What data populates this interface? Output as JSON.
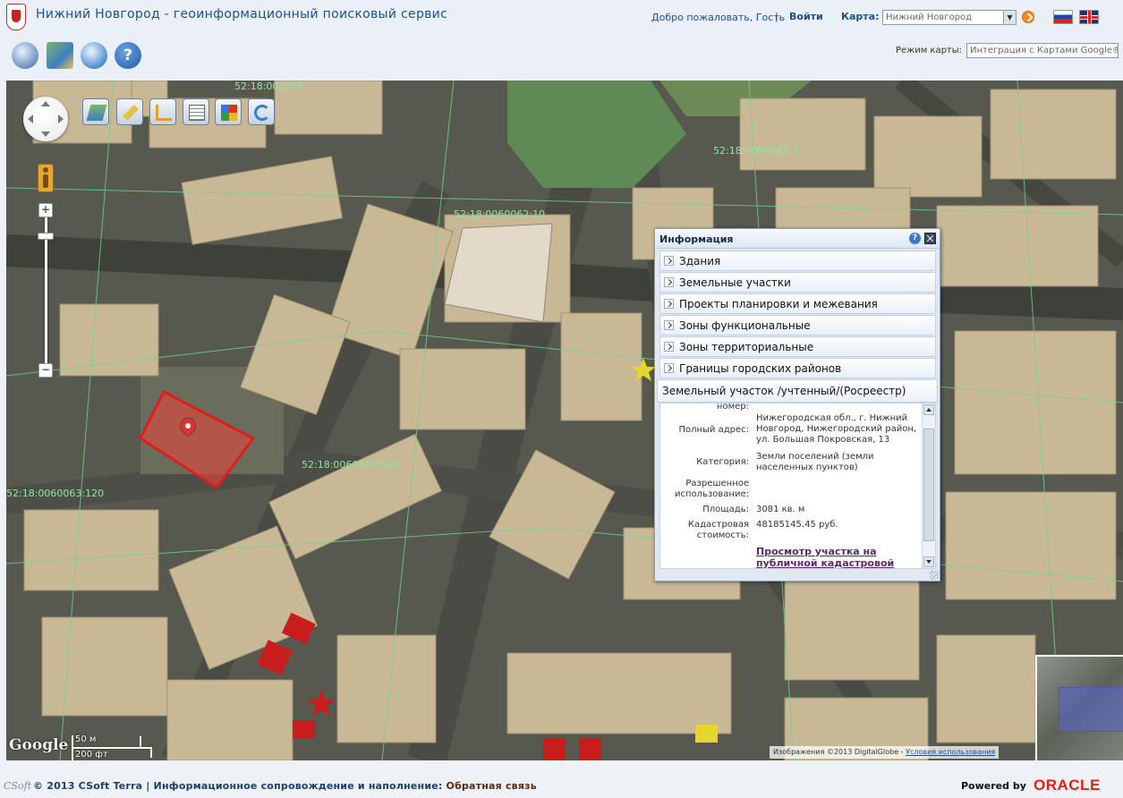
{
  "header": {
    "site_title": "Нижний Новгород - геоинформационный поисковый сервис",
    "welcome": "Добро пожаловать, Гость",
    "separator": "|",
    "login": "Войти",
    "map_label": "Карта:",
    "map_select_value": "Нижний Новгород",
    "map_mode_label": "Режим карты:",
    "map_mode_value": "Интеграция с Картами Google®"
  },
  "toolbar": {
    "help_glyph": "?"
  },
  "map": {
    "zoom_in": "+",
    "zoom_out": "−",
    "google_logo": "Google",
    "scale_metric": "50 м",
    "scale_imperial": "200 фт",
    "attribution_text": "Изображения ©2013 DigitalGlobe - ",
    "attribution_link": "Условия использования",
    "parcel_labels": [
      "52:18:0060062:10",
      "52:18:0060063:120",
      "52:18:0060062:1",
      "52:18:0060063:120",
      "52:18:006006"
    ]
  },
  "info_panel": {
    "title": "Информация",
    "help_glyph": "?",
    "sections": [
      "Здания",
      "Земельные участки",
      "Проекты планировки и межевания",
      "Зоны функциональные",
      "Зоны территориальные",
      "Границы городских районов"
    ],
    "open_section": "Земельный участок /учтенный/(Росреестр)",
    "details": {
      "number_label": "номер:",
      "address_label": "Полный адрес:",
      "address_value": "Нижегородская обл., г. Нижний Новгород, Нижегородский район, ул. Большая Покровская, 13",
      "category_label": "Категория:",
      "category_value": "Земли поселений (земли населенных пунктов)",
      "usage_label": "Разрешенное использование:",
      "area_label": "Площадь:",
      "area_value": "3081 кв. м",
      "cost_label": "Кадастровая стоимость:",
      "cost_value": "48185145.45 руб.",
      "link": "Просмотр участка на публичной кадастровой карте"
    }
  },
  "footer": {
    "csoft": "CSoft",
    "copyright": "© 2013 CSoft Terra | Информационное сопровождение и наполнение: ",
    "feedback": "Обратная связь",
    "powered_by": "Powered by",
    "oracle": "ORACLE"
  }
}
